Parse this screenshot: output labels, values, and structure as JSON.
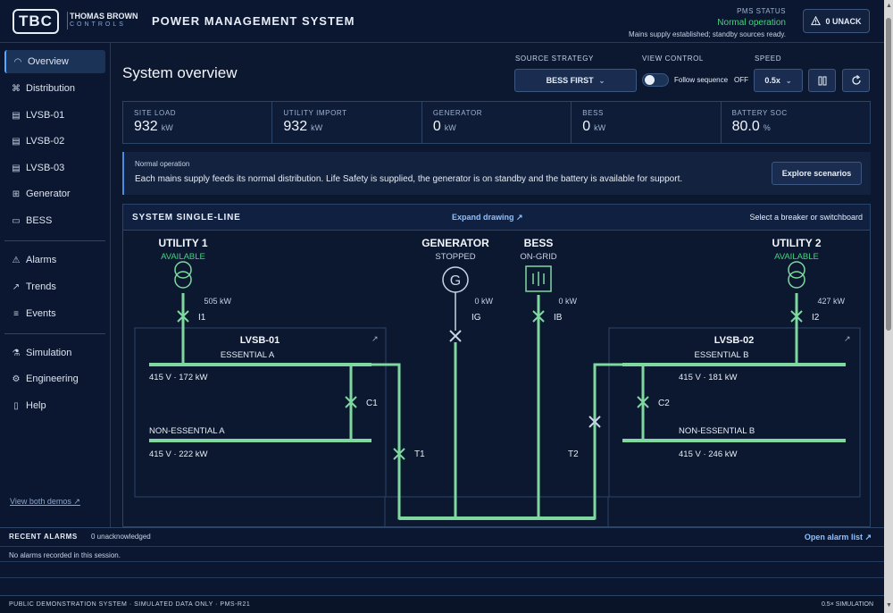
{
  "header": {
    "logo": "TBC",
    "brand_line1": "THOMAS BROWN",
    "brand_line2": "CONTROLS",
    "app_title": "POWER MANAGEMENT SYSTEM",
    "pms_label": "PMS STATUS",
    "pms_value": "Normal operation",
    "pms_desc": "Mains supply established; standby sources ready.",
    "unack_label": "0 UNACK"
  },
  "sidebar": {
    "items": [
      {
        "label": "Overview",
        "icon": "gauge-icon"
      },
      {
        "label": "Distribution",
        "icon": "network-icon"
      },
      {
        "label": "LVSB-01",
        "icon": "switchboard-icon"
      },
      {
        "label": "LVSB-02",
        "icon": "switchboard-icon"
      },
      {
        "label": "LVSB-03",
        "icon": "switchboard-icon"
      },
      {
        "label": "Generator",
        "icon": "generator-icon"
      },
      {
        "label": "BESS",
        "icon": "battery-icon"
      },
      {
        "label": "Alarms",
        "icon": "warning-icon"
      },
      {
        "label": "Trends",
        "icon": "trend-icon"
      },
      {
        "label": "Events",
        "icon": "list-icon"
      },
      {
        "label": "Simulation",
        "icon": "flask-icon"
      },
      {
        "label": "Engineering",
        "icon": "gear-icon"
      },
      {
        "label": "Help",
        "icon": "book-icon"
      }
    ],
    "demos_link": "View both demos ↗"
  },
  "main": {
    "title": "System overview",
    "source_strategy_label": "SOURCE STRATEGY",
    "source_strategy_value": "BESS FIRST",
    "view_control_label": "VIEW CONTROL",
    "follow_sequence": "Follow sequence",
    "follow_state": "OFF",
    "speed_label": "SPEED",
    "speed_value": "0.5x"
  },
  "metrics": [
    {
      "label": "SITE LOAD",
      "value": "932",
      "unit": "kW"
    },
    {
      "label": "UTILITY IMPORT",
      "value": "932",
      "unit": "kW"
    },
    {
      "label": "GENERATOR",
      "value": "0",
      "unit": "kW"
    },
    {
      "label": "BESS",
      "value": "0",
      "unit": "kW"
    },
    {
      "label": "BATTERY SOC",
      "value": "80.0",
      "unit": "%"
    }
  ],
  "notice": {
    "title": "Normal operation",
    "text": "Each mains supply feeds its normal distribution. Life Safety is supplied, the generator is on standby and the battery is available for support.",
    "button": "Explore scenarios"
  },
  "sld": {
    "header": "SYSTEM SINGLE-LINE",
    "expand": "Expand drawing ↗",
    "hint": "Select a breaker or switchboard",
    "utility1": {
      "name": "UTILITY 1",
      "status": "AVAILABLE",
      "power": "505 kW",
      "breaker": "I1"
    },
    "generator": {
      "name": "GENERATOR",
      "status": "STOPPED",
      "power": "0 kW",
      "breaker": "IG",
      "symbol": "G"
    },
    "bess": {
      "name": "BESS",
      "status": "ON-GRID",
      "power": "0 kW",
      "breaker": "IB"
    },
    "utility2": {
      "name": "UTILITY 2",
      "status": "AVAILABLE",
      "power": "427 kW",
      "breaker": "I2"
    },
    "lvsb01": {
      "name": "LVSB-01",
      "bus1": "ESSENTIAL A",
      "bus1_val": "415 V · 172 kW",
      "bus2": "NON-ESSENTIAL A",
      "bus2_val": "415 V · 222 kW",
      "coupler": "C1"
    },
    "lvsb02": {
      "name": "LVSB-02",
      "bus1": "ESSENTIAL B",
      "bus1_val": "415 V · 181 kW",
      "bus2": "NON-ESSENTIAL B",
      "bus2_val": "415 V · 246 kW",
      "coupler": "C2"
    },
    "tie1": "T1",
    "tie2": "T2"
  },
  "alarms": {
    "header": "RECENT ALARMS",
    "count": "0 unacknowledged",
    "open": "Open alarm list ↗",
    "empty": "No alarms recorded in this session."
  },
  "footer": {
    "left": "PUBLIC DEMONSTRATION SYSTEM · SIMULATED DATA ONLY · PMS-R21",
    "right": "0.5× SIMULATION"
  },
  "colors": {
    "energized": "#7fd8a0",
    "deenergized": "#c9d4e4",
    "status_ok": "#3fd67a",
    "accent": "#5aa7ff"
  }
}
